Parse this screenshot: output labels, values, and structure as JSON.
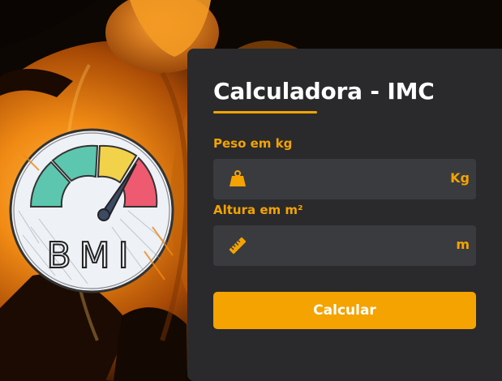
{
  "form": {
    "title": "Calculadora - IMC",
    "weight": {
      "label": "Peso em kg",
      "value": "",
      "placeholder": "",
      "unit": "Kg",
      "icon": "weight-icon"
    },
    "height": {
      "label": "Altura em m²",
      "value": "",
      "placeholder": "",
      "unit": "m",
      "icon": "ruler-icon"
    },
    "submit_label": "Calcular"
  },
  "badge": {
    "text": "BMI"
  },
  "colors": {
    "accent": "#f4a300",
    "card_background": "#2a2a2c",
    "field_background": "#3a3b3f",
    "text_primary": "#ffffff"
  }
}
